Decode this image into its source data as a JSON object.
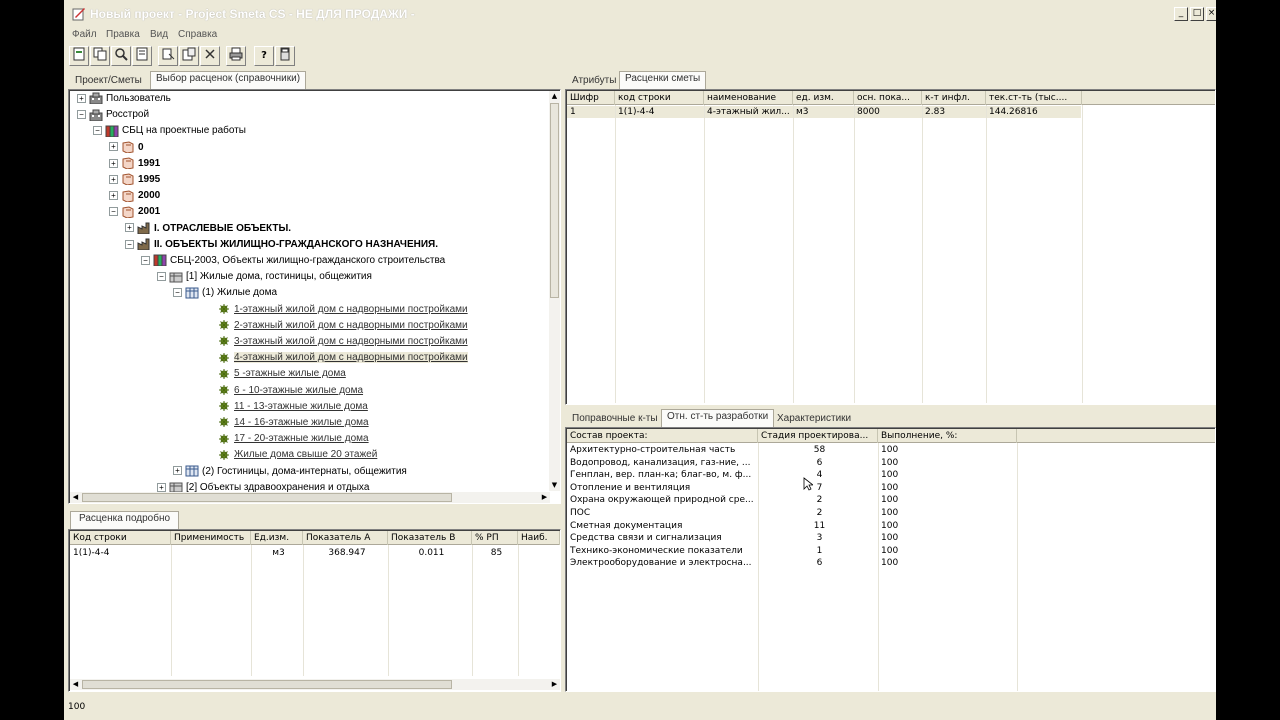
{
  "window": {
    "title": "Новый проект - Project Smeta CS - НЕ ДЛЯ ПРОДАЖИ -",
    "controls": [
      "_",
      "□",
      "×"
    ]
  },
  "menu": [
    "Файл",
    "Правка",
    "Вид",
    "Справка"
  ],
  "left_tabs": [
    "Проект/Сметы",
    "Выбор расценок (справочники)"
  ],
  "tree": [
    {
      "label": "Пользователь",
      "exp": "+",
      "icon": "building-icon"
    },
    {
      "label": "Росстрой",
      "exp": "−",
      "icon": "building-icon"
    },
    {
      "label": "СБЦ на проектные работы",
      "exp": "−",
      "icon": "books-icon"
    },
    {
      "label": "0",
      "exp": "+",
      "icon": "book-icon"
    },
    {
      "label": "1991",
      "exp": "+",
      "icon": "book-icon"
    },
    {
      "label": "1995",
      "exp": "+",
      "icon": "book-icon"
    },
    {
      "label": "2000",
      "exp": "+",
      "icon": "book-icon"
    },
    {
      "label": "2001",
      "exp": "−",
      "icon": "book-icon"
    },
    {
      "label": "I.  ОТРАСЛЕВЫЕ ОБЪЕКТЫ.",
      "exp": "+",
      "icon": "factory-icon"
    },
    {
      "label": "II.  ОБЪЕКТЫ ЖИЛИЩНО-ГРАЖДАНСКОГО НАЗНАЧЕНИЯ.",
      "exp": "−",
      "icon": "factory-icon"
    },
    {
      "label": "СБЦ-2003, Объекты жилищно-гражданского строительства",
      "exp": "−",
      "icon": "books-icon"
    },
    {
      "label": "[1] Жилые дома, гостиницы, общежития",
      "exp": "−",
      "icon": "folder-icon"
    },
    {
      "label": "(1) Жилые дома",
      "exp": "−",
      "icon": "table-icon"
    },
    {
      "label": "1-этажный жилой дом с надворными постройками",
      "icon": "gear-icon"
    },
    {
      "label": "2-этажный жилой дом с надворными постройками",
      "icon": "gear-icon"
    },
    {
      "label": "3-этажный жилой дом с надворными постройками",
      "icon": "gear-icon"
    },
    {
      "label": "4-этажный жилой дом с надворными постройками",
      "icon": "gear-icon"
    },
    {
      "label": "5 -этажные жилые дома",
      "icon": "gear-icon"
    },
    {
      "label": "6 - 10-этажные жилые дома",
      "icon": "gear-icon"
    },
    {
      "label": "11 - 13-этажные жилые дома",
      "icon": "gear-icon"
    },
    {
      "label": "14 - 16-этажные жилые дома",
      "icon": "gear-icon"
    },
    {
      "label": "17 - 20-этажные жилые дома",
      "icon": "gear-icon"
    },
    {
      "label": "Жилые дома свыше 20 этажей",
      "icon": "gear-icon"
    },
    {
      "label": "(2) Гостиницы, дома-интернаты, общежития",
      "exp": "+",
      "icon": "table-icon"
    },
    {
      "label": "[2] Объекты здравоохранения и отдыха",
      "exp": "+",
      "icon": "folder-icon"
    }
  ],
  "detail_tab": "Расценка подробно",
  "detail": {
    "headers": [
      "Код строки",
      "Применимость",
      "Ед.изм.",
      "Показатель А",
      "Показатель В",
      "% РП",
      "Наиб."
    ],
    "rows": [
      [
        "1(1)-4-4",
        "",
        "м3",
        "368.947",
        "0.011",
        "85",
        ""
      ]
    ]
  },
  "right_tabs": [
    "Атрибуты",
    "Расценки сметы"
  ],
  "estimate": {
    "headers": [
      "Шифр",
      "код строки",
      "наименование",
      "ед. изм.",
      "осн. пока...",
      "к-т инфл.",
      "тек.ст-ть (тыс...."
    ],
    "rows": [
      [
        "1",
        "1(1)-4-4",
        "4-этажный жил...",
        "м3",
        "8000",
        "2.83",
        "144.26816"
      ]
    ]
  },
  "bottom_tabs": [
    "Поправочные к-ты",
    "Отн. ст-ть разработки",
    "Характеристики"
  ],
  "stages": {
    "headers": [
      "Состав проекта:",
      "Стадия проектирова...",
      "Выполнение, %:"
    ],
    "rows": [
      [
        "Архитектурно-строительная часть",
        "58",
        "100"
      ],
      [
        "Водопровод, канализация, газ-ние, ...",
        "6",
        "100"
      ],
      [
        "Генплан, вер. план-ка; благ-во, м. ф...",
        "4",
        "100"
      ],
      [
        "Отопление и вентиляция",
        "7",
        "100"
      ],
      [
        "Охрана окружающей природной сре...",
        "2",
        "100"
      ],
      [
        "ПОС",
        "2",
        "100"
      ],
      [
        "Сметная документация",
        "11",
        "100"
      ],
      [
        "Средства связи и сигнализация",
        "3",
        "100"
      ],
      [
        "Технико-экономические показатели",
        "1",
        "100"
      ],
      [
        "Электрооборудование и электросна...",
        "6",
        "100"
      ]
    ]
  },
  "status": "100"
}
